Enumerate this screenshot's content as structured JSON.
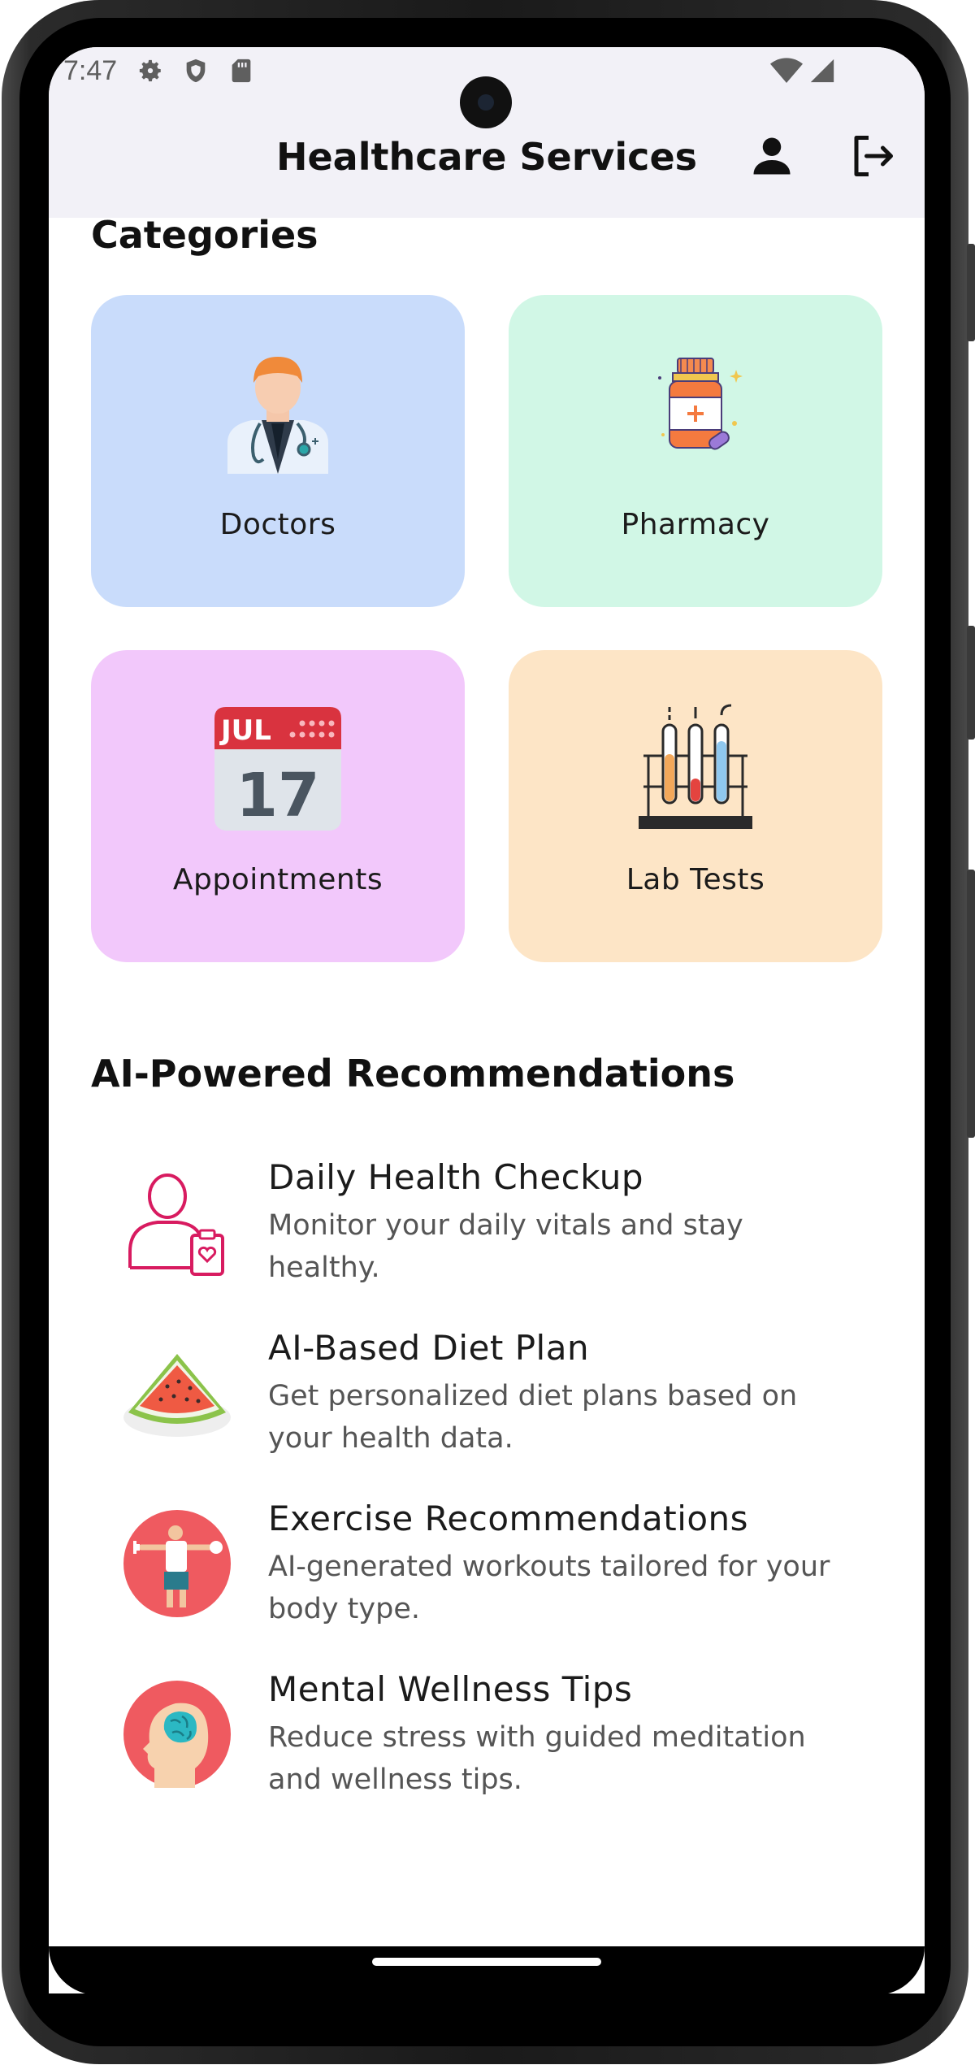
{
  "status_bar": {
    "time": "7:47",
    "left_icons": [
      "settings-gear-icon",
      "shield-icon",
      "sd-card-icon"
    ],
    "right_icons": [
      "wifi-icon",
      "cellular-signal-icon"
    ]
  },
  "app_bar": {
    "title": "Healthcare Services",
    "actions": [
      "profile-icon",
      "logout-icon"
    ]
  },
  "categories": {
    "title": "Categories",
    "items": [
      {
        "label": "Doctors",
        "icon": "doctor-icon",
        "color": "#c9dcfb"
      },
      {
        "label": "Pharmacy",
        "icon": "medicine-bottle-icon",
        "color": "#d1f7e6"
      },
      {
        "label": "Appointments",
        "icon": "calendar-icon",
        "color": "#f2c8fb",
        "calendar_month": "JUL",
        "calendar_day": "17"
      },
      {
        "label": "Lab Tests",
        "icon": "test-tubes-icon",
        "color": "#fde5c6"
      }
    ]
  },
  "recommendations": {
    "title": "AI-Powered Recommendations",
    "items": [
      {
        "title": "Daily Health Checkup",
        "description": "Monitor your daily vitals and stay healthy.",
        "icon": "health-checkup-icon"
      },
      {
        "title": "AI-Based Diet Plan",
        "description": "Get personalized diet plans based on your health data.",
        "icon": "watermelon-icon"
      },
      {
        "title": "Exercise Recommendations",
        "description": "AI-generated workouts tailored for your body type.",
        "icon": "exercise-icon"
      },
      {
        "title": "Mental Wellness Tips",
        "description": "Reduce stress with guided meditation and wellness tips.",
        "icon": "brain-head-icon"
      }
    ]
  }
}
